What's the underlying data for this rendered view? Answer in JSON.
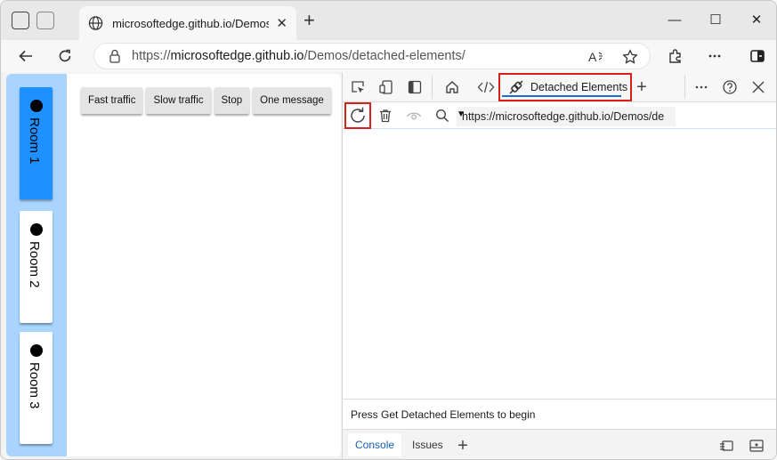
{
  "browser": {
    "tab_title": "microsoftedge.github.io/Demos/detached-elements/",
    "tab_close": "✕",
    "new_tab": "+",
    "window_controls": {
      "minimize": "—",
      "maximize": "☐",
      "close": "✕"
    },
    "address": {
      "scheme": "https://",
      "host": "microsoftedge.github.io",
      "path": "/Demos/detached-elements/"
    },
    "icons": [
      "back-icon",
      "refresh-icon",
      "lock-icon",
      "read-aloud-icon",
      "favorite-star-icon",
      "extensions-icon",
      "more-icon",
      "sidebar-icon"
    ]
  },
  "page": {
    "rooms": [
      {
        "label": "Room 1",
        "active": true
      },
      {
        "label": "Room 2",
        "active": false
      },
      {
        "label": "Room 3",
        "active": false
      }
    ],
    "buttons": [
      "Fast traffic",
      "Slow traffic",
      "Stop",
      "One message"
    ]
  },
  "devtools": {
    "active_tab_label": "Detached Elements",
    "add_tab": "+",
    "target_url": "https://microsoftedge.github.io/Demos/de",
    "status": "Press Get Detached Elements to begin",
    "drawer": {
      "console_label": "Console",
      "issues_label": "Issues",
      "add_label": "+"
    },
    "colors": {
      "highlight": "#d6201c",
      "active_underline": "#1a6ed8",
      "room_active": "#1e90ff",
      "room_sidebar": "#a8d4ff"
    }
  }
}
